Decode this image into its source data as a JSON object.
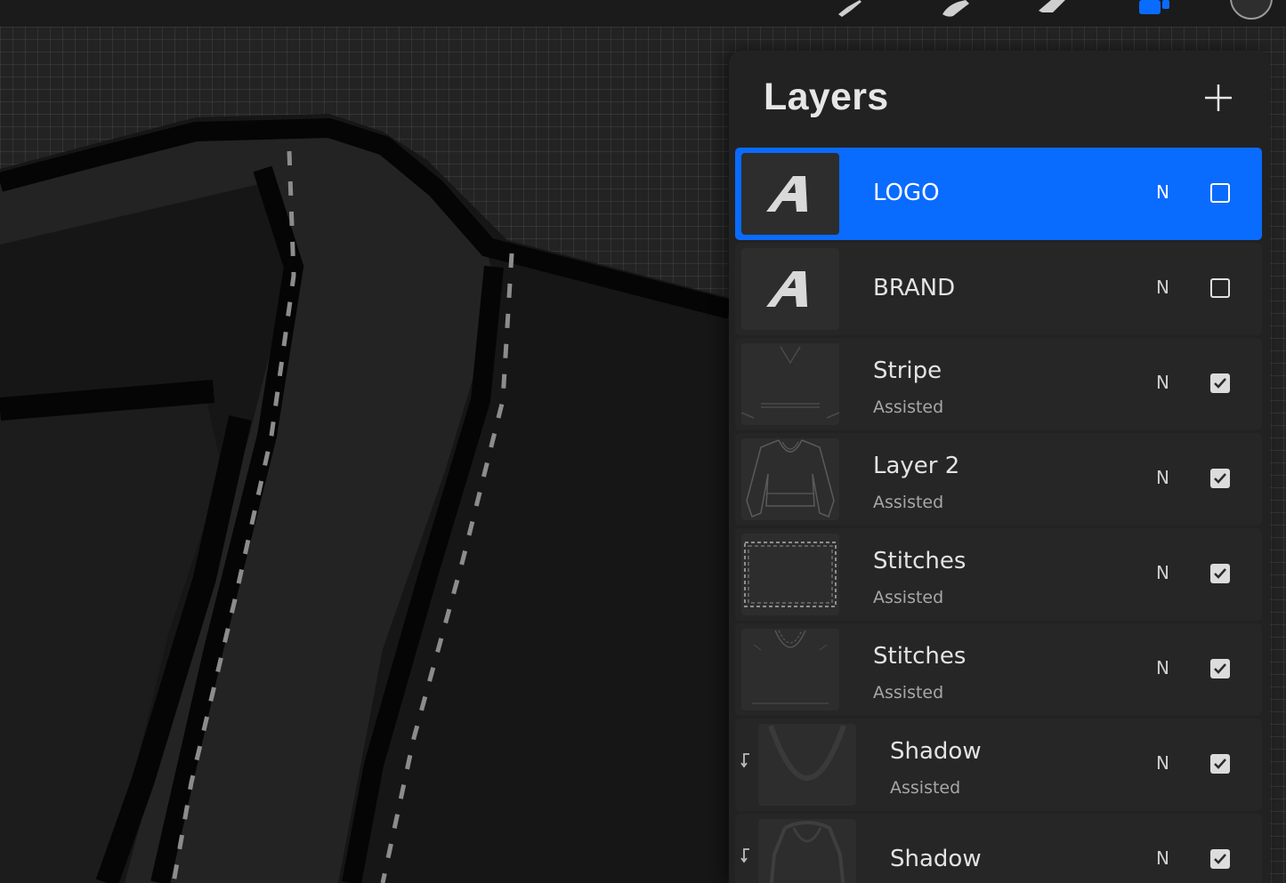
{
  "toolbar": {
    "tools": [
      {
        "name": "brush-icon",
        "active": false
      },
      {
        "name": "smudge-icon",
        "active": false
      },
      {
        "name": "eraser-icon",
        "active": false
      },
      {
        "name": "layers-icon",
        "active": true
      },
      {
        "name": "color-swatch-icon",
        "active": false
      }
    ]
  },
  "layers_panel": {
    "title": "Layers",
    "add_icon": "plus-icon",
    "layers": [
      {
        "name": "LOGO",
        "subtitle": "",
        "blend": "N",
        "visible": false,
        "selected": true,
        "clipped": false,
        "thumb": "text-a"
      },
      {
        "name": "BRAND",
        "subtitle": "",
        "blend": "N",
        "visible": false,
        "selected": false,
        "clipped": false,
        "thumb": "text-a"
      },
      {
        "name": "Stripe",
        "subtitle": "Assisted",
        "blend": "N",
        "visible": true,
        "selected": false,
        "clipped": false,
        "thumb": "stripe"
      },
      {
        "name": "Layer 2",
        "subtitle": "Assisted",
        "blend": "N",
        "visible": true,
        "selected": false,
        "clipped": false,
        "thumb": "sweater"
      },
      {
        "name": "Stitches",
        "subtitle": "Assisted",
        "blend": "N",
        "visible": true,
        "selected": false,
        "clipped": false,
        "thumb": "stitches-frame"
      },
      {
        "name": "Stitches",
        "subtitle": "Assisted",
        "blend": "N",
        "visible": true,
        "selected": false,
        "clipped": false,
        "thumb": "stitches-collar"
      },
      {
        "name": "Shadow",
        "subtitle": "Assisted",
        "blend": "N",
        "visible": true,
        "selected": false,
        "clipped": true,
        "thumb": "shadow-v"
      },
      {
        "name": "Shadow",
        "subtitle": "",
        "blend": "N",
        "visible": true,
        "selected": false,
        "clipped": true,
        "thumb": "shadow-body"
      }
    ]
  },
  "colors": {
    "accent": "#0a6bff",
    "panel_bg": "#222222",
    "row_bg": "#262626"
  }
}
